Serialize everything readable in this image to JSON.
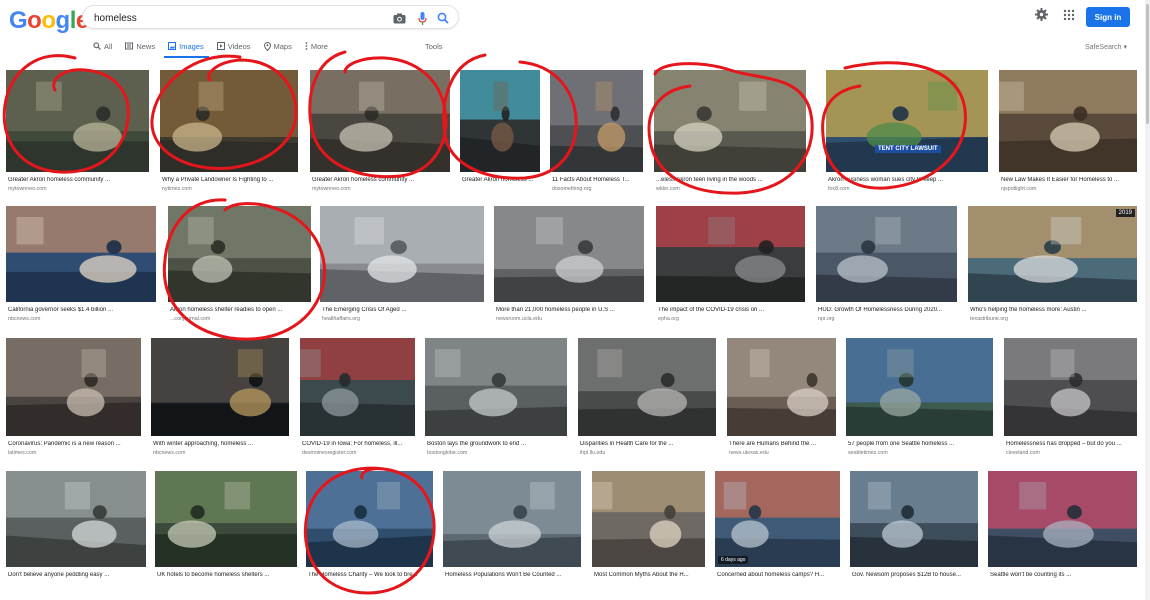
{
  "logo": {
    "letters": [
      "G",
      "o",
      "o",
      "g",
      "l",
      "e"
    ],
    "colors": [
      "#4285F4",
      "#EA4335",
      "#FBBC05",
      "#4285F4",
      "#34A853",
      "#EA4335"
    ]
  },
  "search": {
    "query": "homeless"
  },
  "header": {
    "sign_in": "Sign in"
  },
  "tabs": [
    {
      "label": "All",
      "icon": "search-icon"
    },
    {
      "label": "News",
      "icon": "news-icon"
    },
    {
      "label": "Images",
      "icon": "image-icon"
    },
    {
      "label": "Videos",
      "icon": "video-icon"
    },
    {
      "label": "Maps",
      "icon": "map-pin-icon"
    },
    {
      "label": "More",
      "icon": "more-vert-icon"
    }
  ],
  "tools": "Tools",
  "safesearch": "SafeSearch",
  "results": [
    {
      "caption": "Greater Akron homeless community ...",
      "source": "mytownneo.com"
    },
    {
      "caption": "Why a Private Landowner Is Fighting to ...",
      "source": "nytimes.com"
    },
    {
      "caption": "Greater Akron homeless community ...",
      "source": "mytownneo.com"
    },
    {
      "caption": "Greater Akron homeless ...",
      "source": ""
    },
    {
      "caption": "11 Facts About Homeless T...",
      "source": "dosomething.org"
    },
    {
      "caption": "...eless Akron teen living in the woods ...",
      "source": "wkbn.com"
    },
    {
      "caption": "Akron business woman sues city to keep ...",
      "source": "fox8.com",
      "overlay": "TENT CITY LAWSUIT"
    },
    {
      "caption": "New Law Makes It Easier for Homeless to ...",
      "source": "njspotlight.com"
    },
    {
      "caption": "California governor seeks $1.4 billion ...",
      "source": "nbcnews.com"
    },
    {
      "caption": "Akron homeless shelter readies to open ...",
      "source": "...conjournal.com"
    },
    {
      "caption": "The Emerging Crisis Of Aged ...",
      "source": "healthaffairs.org"
    },
    {
      "caption": "More than 21,000 homeless people in U.S ...",
      "source": "newsroom.ucla.edu"
    },
    {
      "caption": "The impact of the COVID-19 crisis on ...",
      "source": "epha.org"
    },
    {
      "caption": "HUD: Growth Of Homelessness During 2020...",
      "source": "npr.org"
    },
    {
      "caption": "Who's helping the homeless more: Austin ...",
      "source": "texastribune.org",
      "year": "2019"
    },
    {
      "caption": "Coronavirus: Pandemic is a new reason ...",
      "source": "latimes.com"
    },
    {
      "caption": "With winter approaching, homeless ...",
      "source": "nbcnews.com"
    },
    {
      "caption": "COVID-19 in Iowa: For homeless, ill...",
      "source": "desmoinesregister.com"
    },
    {
      "caption": "Boston lays the groundwork to end ...",
      "source": "bostonglobe.com"
    },
    {
      "caption": "Disparities in Health Care for the ...",
      "source": "ihpl.llu.edu"
    },
    {
      "caption": "There are Humans Behind the ...",
      "source": "news.utexas.edu"
    },
    {
      "caption": "57 people from one Seattle homeless ...",
      "source": "seattletimes.com"
    },
    {
      "caption": "Homelessness has dropped – but do you ...",
      "source": "cleveland.com"
    },
    {
      "caption": "Don't believe anyone peddling easy ...",
      "source": ""
    },
    {
      "caption": "UK hotels to become homeless shelters ...",
      "source": ""
    },
    {
      "caption": "The Homeless Charity – We look to bre...",
      "source": ""
    },
    {
      "caption": "Homeless Populations Won't Be Counted ...",
      "source": ""
    },
    {
      "caption": "Most Common Myths About the H...",
      "source": ""
    },
    {
      "caption": "Concerned about homeless camps? H...",
      "source": "",
      "badge": "6 days ago"
    },
    {
      "caption": "Gov. Newsom proposes $12B to house...",
      "source": ""
    },
    {
      "caption": "Seattle won't be counting its ...",
      "source": ""
    }
  ]
}
